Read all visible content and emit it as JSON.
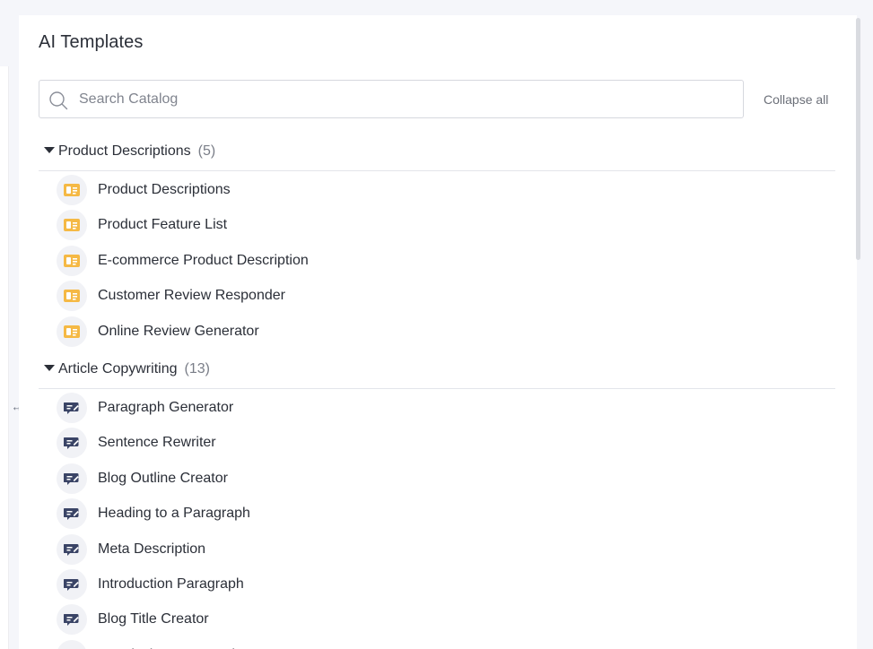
{
  "page": {
    "title": "AI Templates"
  },
  "search": {
    "placeholder": "Search Catalog",
    "value": ""
  },
  "toolbar": {
    "collapse_all_label": "Collapse all"
  },
  "colors": {
    "accent_yellow": "#f5b945",
    "accent_navy": "#3a4466",
    "text": "#2b2f38"
  },
  "groups": [
    {
      "title": "Product Descriptions",
      "count": "(5)",
      "icon": "product-card-icon",
      "items": [
        "Product Descriptions",
        "Product Feature List",
        "E-commerce Product Description",
        "Customer Review Responder",
        "Online Review Generator"
      ]
    },
    {
      "title": "Article Copywriting",
      "count": "(13)",
      "icon": "article-edit-icon",
      "items": [
        "Paragraph Generator",
        "Sentence Rewriter",
        "Blog Outline Creator",
        "Heading to a Paragraph",
        "Meta Description",
        "Introduction Paragraph",
        "Blog Title Creator",
        "Conclusion Paragraph"
      ]
    }
  ]
}
